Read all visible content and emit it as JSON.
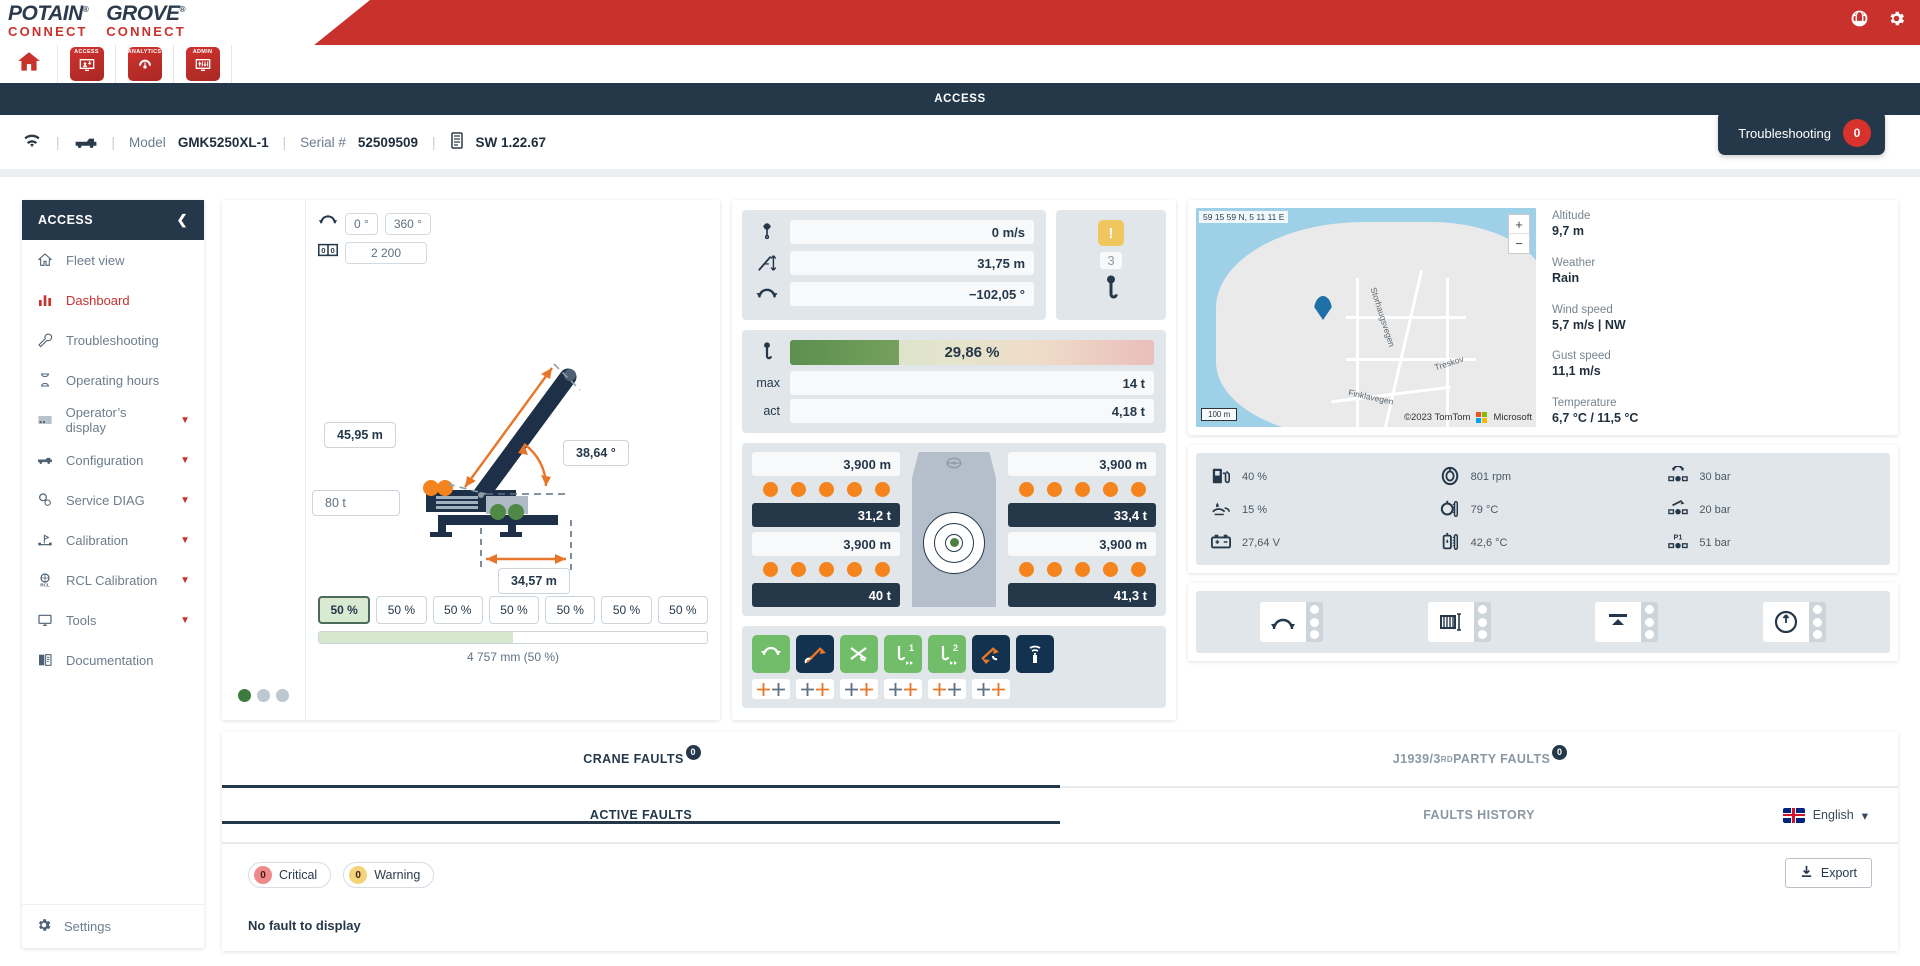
{
  "brand": {
    "logo1_main": "POTAIN",
    "logo1_sub": "CONNECT",
    "logo2_main": "GROVE",
    "logo2_sub": "CONNECT",
    "reg": "®",
    "tm": "™"
  },
  "topnav": {
    "items": [
      {
        "label": "",
        "icon": "home-icon"
      },
      {
        "label": "ACCESS",
        "icon": "access-icon"
      },
      {
        "label": "ANALYTICS",
        "icon": "analytics-icon"
      },
      {
        "label": "ADMIN",
        "icon": "admin-icon"
      }
    ],
    "globe_icon": "globe-icon",
    "settings_icon": "gear-icon"
  },
  "section_banner": "ACCESS",
  "infobar": {
    "wifi_icon": "wifi-icon",
    "crane_icon": "crane-icon",
    "model_label": "Model",
    "model_value": "GMK5250XL-1",
    "serial_label": "Serial #",
    "serial_value": "52509509",
    "sw_icon": "chip-icon",
    "sw_value": "SW 1.22.67",
    "troubleshooting_label": "Troubleshooting",
    "troubleshooting_count": "0"
  },
  "sidebar": {
    "title": "ACCESS",
    "collapse_icon": "chevron-left-icon",
    "items": [
      {
        "label": "Fleet view",
        "icon": "home-outline-icon",
        "expandable": false,
        "active": false
      },
      {
        "label": "Dashboard",
        "icon": "bar-chart-icon",
        "expandable": false,
        "active": true
      },
      {
        "label": "Troubleshooting",
        "icon": "wrench-icon",
        "expandable": false,
        "active": false
      },
      {
        "label": "Operating hours",
        "icon": "hourglass-icon",
        "expandable": false,
        "active": false
      },
      {
        "label": "Operator’s display",
        "icon": "display-icon",
        "expandable": true,
        "active": false
      },
      {
        "label": "Configuration",
        "icon": "truck-icon",
        "expandable": true,
        "active": false
      },
      {
        "label": "Service DIAG",
        "icon": "gears-icon",
        "expandable": true,
        "active": false
      },
      {
        "label": "Calibration",
        "icon": "calibration-icon",
        "expandable": true,
        "active": false
      },
      {
        "label": "RCL Calibration",
        "icon": "rcl-icon",
        "expandable": true,
        "active": false
      },
      {
        "label": "Tools",
        "icon": "monitor-icon",
        "expandable": true,
        "active": false
      },
      {
        "label": "Documentation",
        "icon": "book-icon",
        "expandable": false,
        "active": false
      }
    ],
    "settings_label": "Settings",
    "settings_icon": "gear-icon"
  },
  "crane": {
    "slew_icon": "slew-icon",
    "slew_min": "0 °",
    "slew_max": "360 °",
    "counter_icon": "counter-icon",
    "counter_value": "2 200",
    "boom_length": "45,95 m",
    "boom_angle": "38,64 °",
    "counterweight": "80 t",
    "radius": "34,57 m",
    "pct_buttons": [
      "50 %",
      "50 %",
      "50 %",
      "50 %",
      "50 %",
      "50 %",
      "50 %"
    ],
    "pct_selected_index": 0,
    "progress_pct": 50,
    "progress_caption": "4 757 mm (50 %)",
    "status_dots": [
      true,
      false,
      false
    ]
  },
  "measurements": {
    "rows": [
      {
        "icon": "hook-speed-icon",
        "value": "0 m/s"
      },
      {
        "icon": "height-icon",
        "value": "31,75 m"
      },
      {
        "icon": "slew-angle-icon",
        "value": "−102,05 °"
      }
    ],
    "warning_mark": "!",
    "falls_count": "3",
    "hook_icon": "hook-icon"
  },
  "load": {
    "utilization_pct": "29,86 %",
    "utilization_value": 29.86,
    "max_label": "max",
    "max_value": "14 t",
    "act_label": "act",
    "act_value": "4,18 t",
    "hook_icon": "hook-icon"
  },
  "outriggers": {
    "front_left_dist": "3,900 m",
    "front_right_dist": "3,900 m",
    "rear_left_dist": "3,900 m",
    "rear_right_dist": "3,900 m",
    "front_left_load": "31,2 t",
    "front_right_load": "33,4 t",
    "rear_left_load": "40 t",
    "rear_right_load": "41,3 t",
    "pad_count": 5,
    "cab_icon": "steering-wheel-icon",
    "level_icon": "level-bubble-icon"
  },
  "function_buttons": [
    {
      "icon": "slew-function-icon",
      "state": "green"
    },
    {
      "icon": "telescope-function-icon",
      "state": "dark"
    },
    {
      "icon": "luffing-function-icon",
      "state": "green"
    },
    {
      "icon": "winch-1-icon",
      "state": "green"
    },
    {
      "icon": "winch-2-icon",
      "state": "green"
    },
    {
      "icon": "boom-alert-icon",
      "state": "dark"
    },
    {
      "icon": "antenna-icon",
      "state": "dark"
    }
  ],
  "cross_buttons": [
    {
      "icon": "axis-cross-icon"
    },
    {
      "icon": "axis-cross-icon"
    },
    {
      "icon": "axis-cross-icon"
    },
    {
      "icon": "axis-cross-icon"
    },
    {
      "icon": "axis-cross-icon"
    },
    {
      "icon": "axis-cross-icon"
    }
  ],
  "map": {
    "coordinates": "59 15 59 N, 5 11 11 E",
    "zoom_in": "+",
    "zoom_out": "−",
    "scale_label": "100 m",
    "attribution": "©2023 TomTom",
    "provider": "Microsoft",
    "roads": [
      "Storhaugsvegen",
      "Treskov",
      "Finklavegen"
    ]
  },
  "weather": [
    {
      "label": "Altitude",
      "value": "9,7 m"
    },
    {
      "label": "Weather",
      "value": "Rain"
    },
    {
      "label": "Wind speed",
      "value": "5,7 m/s | NW"
    },
    {
      "label": "Gust speed",
      "value": "11,1 m/s"
    },
    {
      "label": "Temperature",
      "value": "6,7 °C / 11,5 °C"
    }
  ],
  "gauges": [
    {
      "icon": "fuel-icon",
      "value": "40 %",
      "fill": 40
    },
    {
      "icon": "engine-rpm-icon",
      "value": "801 rpm",
      "fill": 38
    },
    {
      "icon": "pressure-1-icon",
      "value": "30 bar",
      "fill": 6
    },
    {
      "icon": "def-fluid-icon",
      "value": "15 %",
      "fill": 16
    },
    {
      "icon": "coolant-temp-icon",
      "value": "79 °C",
      "fill": 72
    },
    {
      "icon": "pressure-2-icon",
      "value": "20 bar",
      "fill": 5
    },
    {
      "icon": "battery-icon",
      "value": "27,64 V",
      "fill": 86
    },
    {
      "icon": "oil-temp-icon",
      "value": "42,6 °C",
      "fill": 48
    },
    {
      "icon": "pressure-p1-icon",
      "value": "51 bar",
      "fill": 14
    }
  ],
  "quick_status": [
    {
      "icon": "slew-brake-icon",
      "leds": 3
    },
    {
      "icon": "winch-drum-icon",
      "leds": 3
    },
    {
      "icon": "outrigger-up-icon",
      "leds": 3
    },
    {
      "icon": "pressure-gauge-icon",
      "leds": 3
    }
  ],
  "faults": {
    "tabs_primary": [
      {
        "label": "CRANE FAULTS",
        "count": "0",
        "active": true
      },
      {
        "label": "J1939/3",
        "sup": "RD",
        "label2": " PARTY FAULTS",
        "count": "0",
        "active": false
      }
    ],
    "tabs_secondary": [
      {
        "label": "ACTIVE FAULTS",
        "active": true
      },
      {
        "label": "FAULTS HISTORY",
        "active": false
      }
    ],
    "language_label": "English",
    "language_caret": "▾",
    "chips": [
      {
        "count": "0",
        "label": "Critical",
        "kind": "crit"
      },
      {
        "count": "0",
        "label": "Warning",
        "kind": "warn"
      }
    ],
    "empty_message": "No fault to display",
    "export_label": "Export",
    "export_icon": "download-icon"
  }
}
